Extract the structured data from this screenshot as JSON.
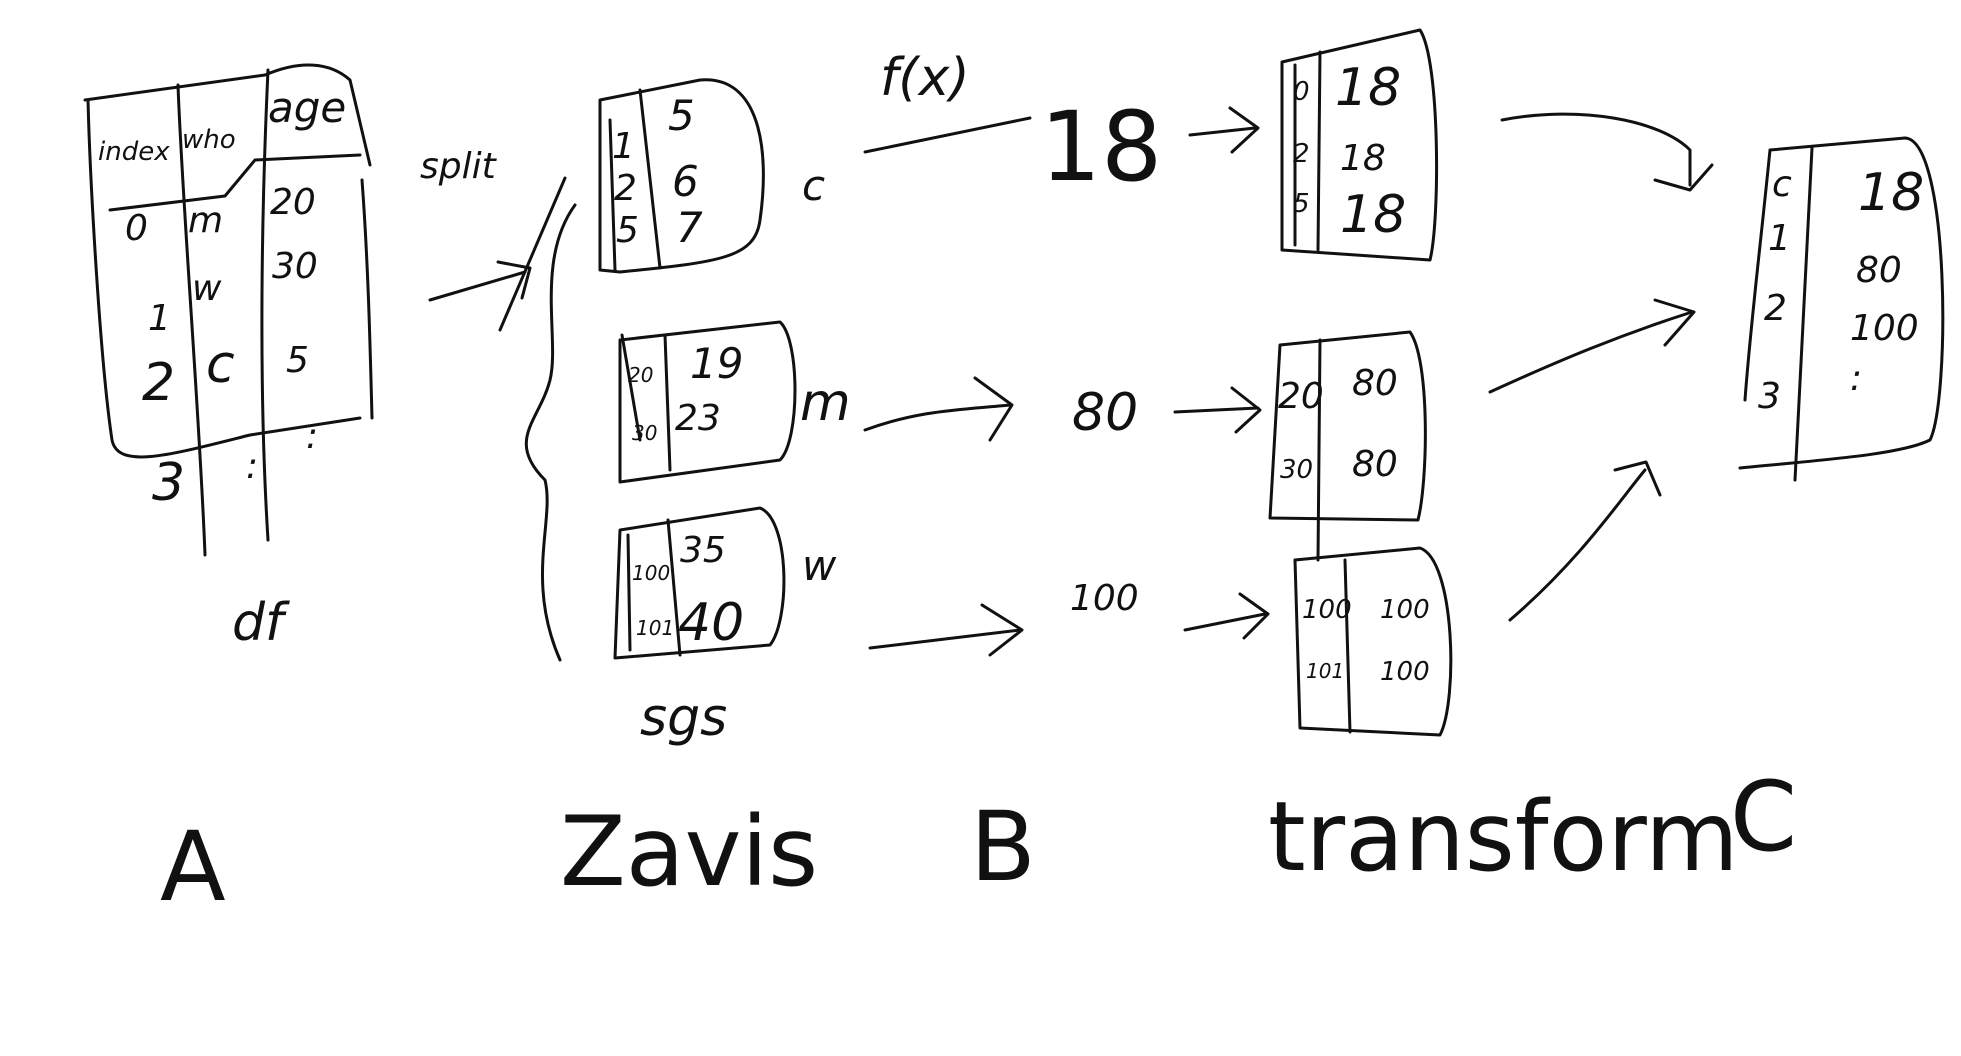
{
  "df_table": {
    "headers": [
      "index",
      "who",
      "age"
    ],
    "rows": [
      [
        "0",
        "m",
        "20"
      ],
      [
        "1",
        "w",
        "30"
      ],
      [
        "2",
        "c",
        "5"
      ],
      [
        "3",
        ":",
        ":"
      ]
    ],
    "label": "df"
  },
  "split_label": "split",
  "groups": [
    {
      "key": "c",
      "rows": [
        [
          "1",
          "5"
        ],
        [
          "2",
          "6"
        ],
        [
          "5",
          "7"
        ]
      ]
    },
    {
      "key": "m",
      "rows": [
        [
          "20",
          "19"
        ],
        [
          "30",
          "23"
        ]
      ]
    },
    {
      "key": "w",
      "rows": [
        [
          "100",
          "35"
        ],
        [
          "101",
          "40"
        ]
      ]
    }
  ],
  "sgs_label": "sgs",
  "func_label": "f(x)",
  "results": [
    "18",
    "80",
    "100"
  ],
  "transformed": [
    {
      "rows": [
        [
          "0",
          "18"
        ],
        [
          "2",
          "18"
        ],
        [
          "5",
          "18"
        ]
      ]
    },
    {
      "rows": [
        [
          "20",
          "80"
        ],
        [
          "30",
          "80"
        ]
      ]
    },
    {
      "rows": [
        [
          "100",
          "100"
        ],
        [
          "101",
          "100"
        ]
      ]
    }
  ],
  "final_table": {
    "rows": [
      [
        "c",
        "18"
      ],
      [
        "1",
        "80"
      ],
      [
        "2",
        "100"
      ],
      [
        "3",
        ":"
      ]
    ]
  },
  "stage_labels": {
    "a": "A",
    "zavis": "Zavis",
    "b": "B",
    "transform": "transform",
    "c": "C"
  }
}
